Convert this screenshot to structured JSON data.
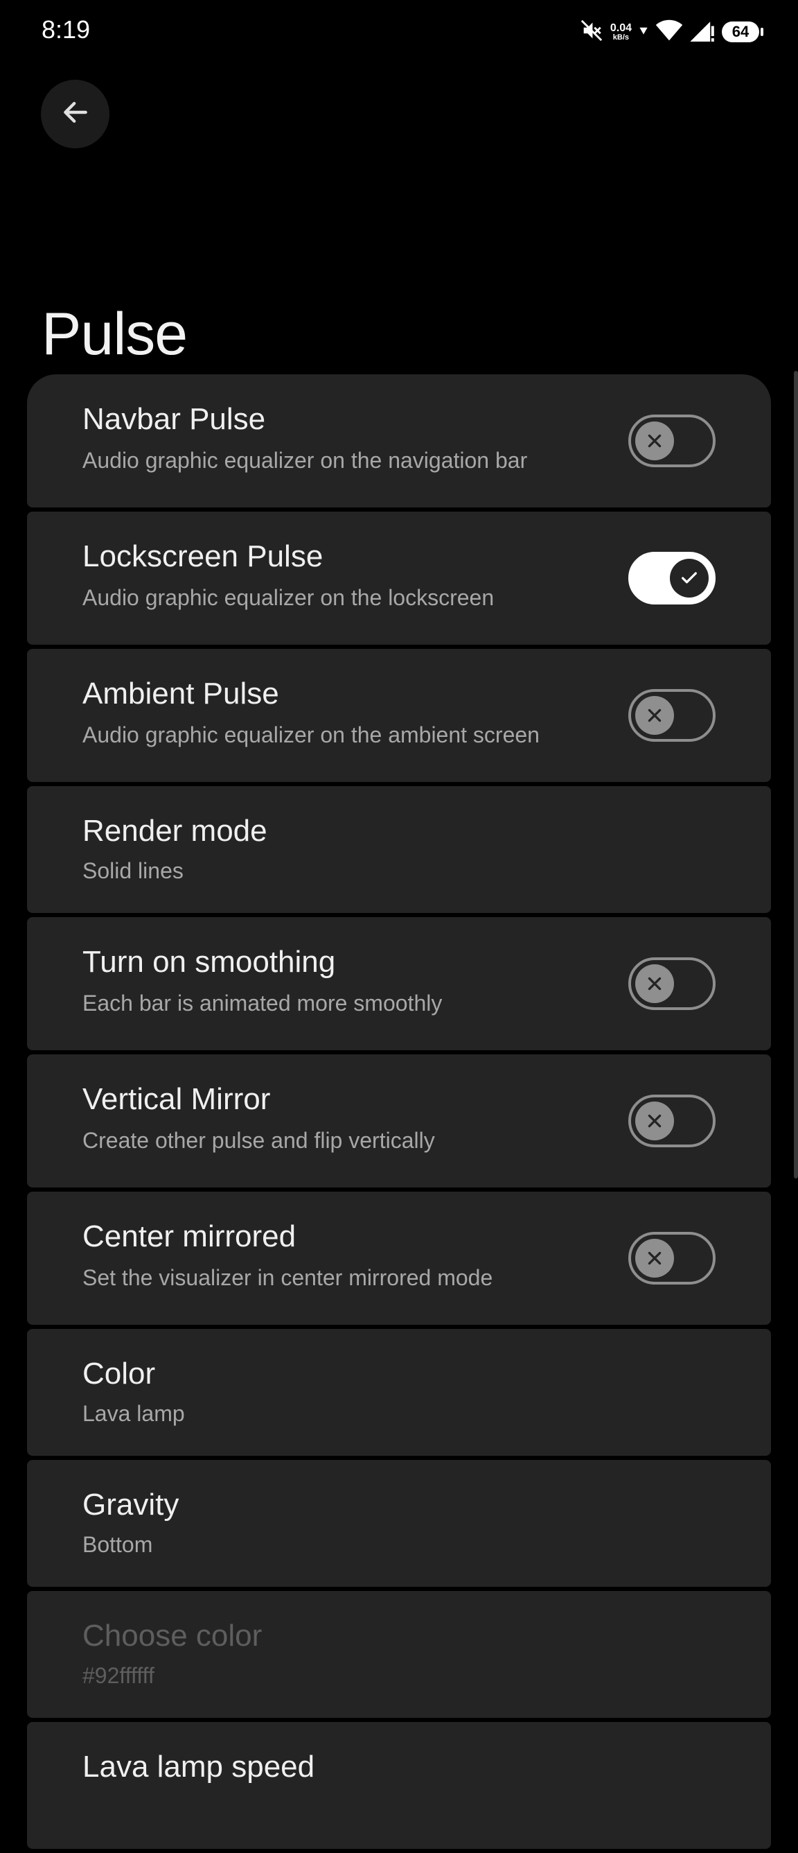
{
  "status_bar": {
    "time": "8:19",
    "net_speed_value": "0.04",
    "net_speed_unit": "kB/s",
    "battery": "64",
    "icons": [
      "mute-icon",
      "data-arrow-icon",
      "wifi-icon",
      "signal-icon",
      "battery-icon"
    ]
  },
  "header": {
    "back_icon": "arrow-left-icon",
    "title": "Pulse"
  },
  "settings": [
    {
      "title": "Navbar Pulse",
      "summary": "Audio graphic equalizer on the navigation bar",
      "toggle": false
    },
    {
      "title": "Lockscreen Pulse",
      "summary": "Audio graphic equalizer on the lockscreen",
      "toggle": true
    },
    {
      "title": "Ambient Pulse",
      "summary": "Audio graphic equalizer on the ambient screen",
      "toggle": false
    },
    {
      "title": "Render mode",
      "summary": "Solid lines"
    },
    {
      "title": "Turn on smoothing",
      "summary": "Each bar is animated more smoothly",
      "toggle": false
    },
    {
      "title": "Vertical Mirror",
      "summary": "Create other pulse and flip vertically",
      "toggle": false
    },
    {
      "title": "Center mirrored",
      "summary": "Set the visualizer in center mirrored mode",
      "toggle": false
    },
    {
      "title": "Color",
      "summary": "Lava lamp"
    },
    {
      "title": "Gravity",
      "summary": "Bottom"
    },
    {
      "title": "Choose color",
      "summary": "#92ffffff",
      "disabled": true
    },
    {
      "title": "Lava lamp speed",
      "summary": ""
    }
  ],
  "colors": {
    "background": "#000000",
    "card": "#242424",
    "toggle_on_track": "#ffffff",
    "toggle_off_border": "#8e8e8e",
    "summary_text": "#a8a8a8",
    "disabled_text": "#5e5e5e"
  }
}
